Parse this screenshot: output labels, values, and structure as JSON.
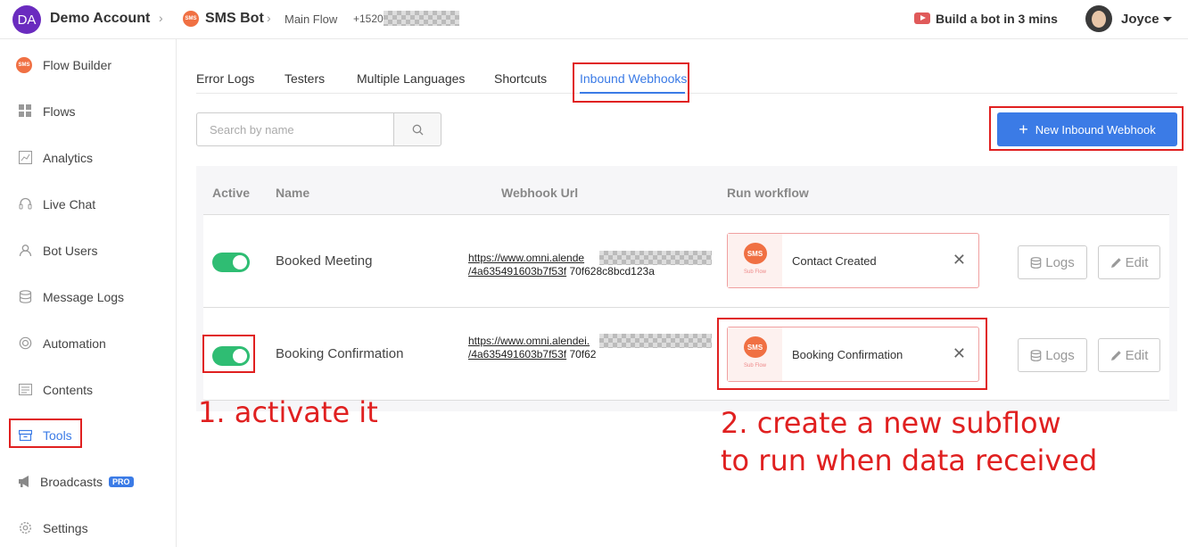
{
  "topbar": {
    "account_initials": "DA",
    "account_name": "Demo Account",
    "bot_logo": "SMS",
    "bot_name": "SMS Bot",
    "flow_name": "Main Flow",
    "phone_prefix": "+1520",
    "build_label": "Build a bot in 3 mins",
    "user_name": "Joyce"
  },
  "sidebar": {
    "items": [
      {
        "label": "Flow Builder",
        "icon": "sms-logo-icon"
      },
      {
        "label": "Flows",
        "icon": "grid-icon"
      },
      {
        "label": "Analytics",
        "icon": "chart-icon"
      },
      {
        "label": "Live Chat",
        "icon": "headset-icon"
      },
      {
        "label": "Bot Users",
        "icon": "user-icon"
      },
      {
        "label": "Message Logs",
        "icon": "database-icon"
      },
      {
        "label": "Automation",
        "icon": "automation-icon"
      },
      {
        "label": "Contents",
        "icon": "contents-icon"
      },
      {
        "label": "Tools",
        "icon": "toolbox-icon"
      },
      {
        "label": "Broadcasts",
        "icon": "megaphone-icon",
        "badge": "PRO"
      },
      {
        "label": "Settings",
        "icon": "gear-icon"
      }
    ]
  },
  "tabs": [
    {
      "label": "Error Logs"
    },
    {
      "label": "Testers"
    },
    {
      "label": "Multiple Languages"
    },
    {
      "label": "Shortcuts"
    },
    {
      "label": "Inbound Webhooks"
    }
  ],
  "search": {
    "placeholder": "Search by name"
  },
  "new_button_label": "New Inbound Webhook",
  "table": {
    "headers": [
      "Active",
      "Name",
      "Webhook Url",
      "Run workflow"
    ],
    "rows": [
      {
        "name": "Booked Meeting",
        "url_line1": "https://www.omni.alende",
        "url_line2_link": "/4a635491603b7f53f",
        "url_line2_rest": " 70f628c8bcd123a",
        "workflow": "Contact Created",
        "workflow_logo": "SMS",
        "workflow_caption": "Sub Flow",
        "logs_label": "Logs",
        "edit_label": "Edit"
      },
      {
        "name": "Booking Confirmation",
        "url_line1": "https://www.omni.alendei.",
        "url_line2_link": "/4a635491603b7f53f",
        "url_line2_rest": " 70f62",
        "workflow": "Booking Confirmation",
        "workflow_logo": "SMS",
        "workflow_caption": "Sub Flow",
        "logs_label": "Logs",
        "edit_label": "Edit"
      }
    ]
  },
  "annotations": {
    "step1": "1. activate it",
    "step2_line1": "2. create a new subflow",
    "step2_line2": "to run when data received"
  },
  "colors": {
    "accent": "#3b7be6",
    "toggle_on": "#2fbd73",
    "annotation": "#e02020",
    "brand": "#f07043"
  }
}
